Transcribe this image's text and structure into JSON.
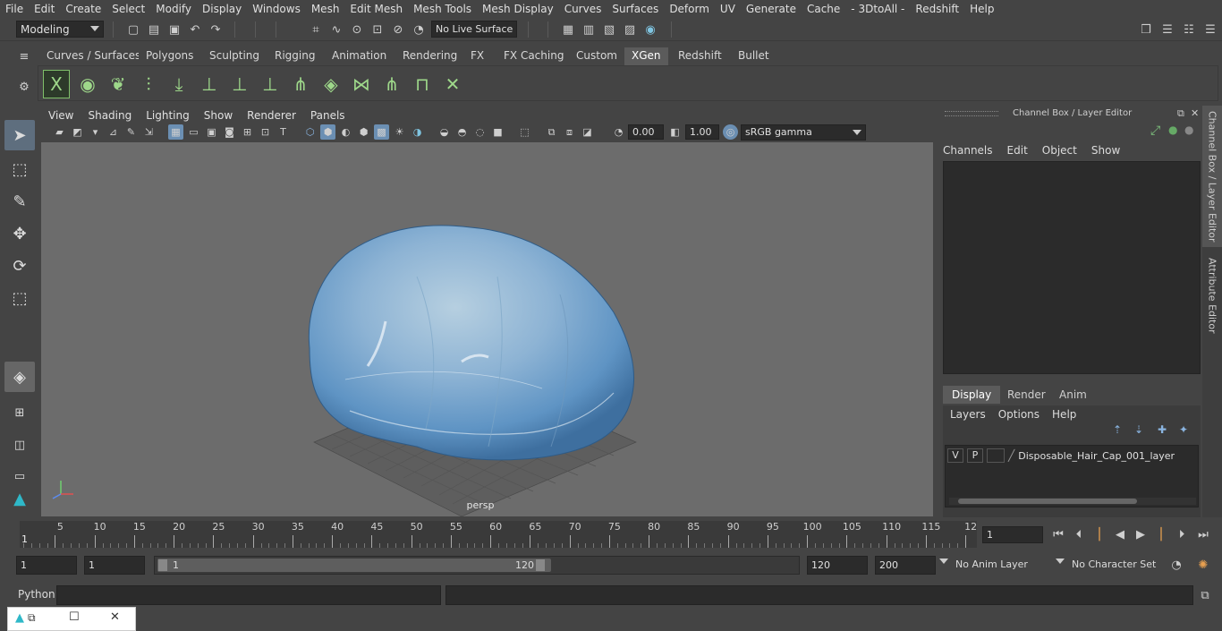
{
  "menubar": {
    "items": [
      "File",
      "Edit",
      "Create",
      "Select",
      "Modify",
      "Display",
      "Windows",
      "Mesh",
      "Edit Mesh",
      "Mesh Tools",
      "Mesh Display",
      "Curves",
      "Surfaces",
      "Deform",
      "UV",
      "Generate",
      "Cache",
      "- 3DtoAll -",
      "Redshift",
      "Help"
    ]
  },
  "status": {
    "workspace": "Modeling",
    "live_surface": "No Live Surface"
  },
  "shelf": {
    "tabs": [
      "Curves / Surfaces",
      "Polygons",
      "Sculpting",
      "Rigging",
      "Animation",
      "Rendering",
      "FX",
      "FX Caching",
      "Custom",
      "XGen",
      "Redshift",
      "Bullet"
    ],
    "active_tab": "XGen"
  },
  "panel": {
    "menu": [
      "View",
      "Shading",
      "Lighting",
      "Show",
      "Renderer",
      "Panels"
    ],
    "exposure": "0.00",
    "gamma": "1.00",
    "color_space": "sRGB gamma",
    "camera_label": "persp"
  },
  "channel_box": {
    "title": "Channel Box / Layer Editor",
    "menu": [
      "Channels",
      "Edit",
      "Object",
      "Show"
    ]
  },
  "layer_editor": {
    "tabs": [
      "Display",
      "Render",
      "Anim"
    ],
    "active_tab": "Display",
    "menu": [
      "Layers",
      "Options",
      "Help"
    ],
    "layer": {
      "visible": "V",
      "playback": "P",
      "name": "Disposable_Hair_Cap_001_layer"
    }
  },
  "side_tabs": [
    "Channel Box / Layer Editor",
    "Attribute Editor"
  ],
  "timeline": {
    "tick_labels": [
      "5",
      "10",
      "15",
      "20",
      "25",
      "30",
      "35",
      "40",
      "45",
      "50",
      "55",
      "60",
      "65",
      "70",
      "75",
      "80",
      "85",
      "90",
      "95",
      "100",
      "105",
      "110",
      "115",
      "12"
    ],
    "start_marker": "1",
    "current_frame": "1"
  },
  "range": {
    "start": "1",
    "playback_start": "1",
    "slider_start": "1",
    "slider_end": "120",
    "playback_end": "120",
    "end": "200",
    "anim_layer": "No Anim Layer",
    "character_set": "No Character Set"
  },
  "command_line": {
    "label": "Python"
  },
  "colors": {
    "bg": "#444444",
    "viewport": "#6c6c6c",
    "accent": "#5b5b5b",
    "cap_blue": "#6f9fc8"
  }
}
